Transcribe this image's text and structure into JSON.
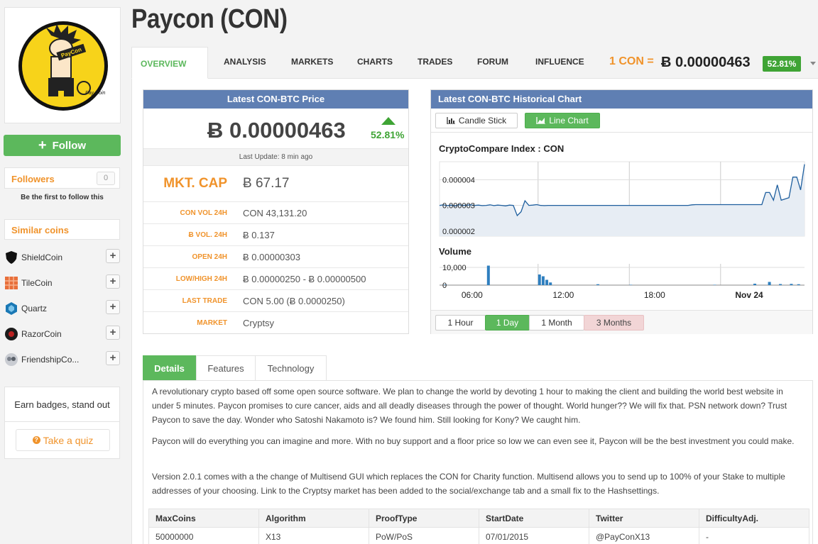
{
  "coin": {
    "title": "Paycon (CON)",
    "logo_text": "PayCon",
    "logo_sub": "Pay Coin"
  },
  "sidebar": {
    "follow_label": "Follow",
    "followers_label": "Followers",
    "followers_count": "0",
    "be_first": "Be the first to follow this",
    "similar_title": "Similar coins",
    "similar": [
      {
        "name": "ShieldCoin",
        "icon": "shield-coin-icon"
      },
      {
        "name": "TileCoin",
        "icon": "tile-coin-icon"
      },
      {
        "name": "Quartz",
        "icon": "quartz-icon"
      },
      {
        "name": "RazorCoin",
        "icon": "razor-coin-icon"
      },
      {
        "name": "FriendshipCo...",
        "icon": "friendship-coin-icon"
      }
    ],
    "badges_text": "Earn badges, stand out",
    "quiz_label": "Take a quiz"
  },
  "nav": {
    "tabs": [
      "OVERVIEW",
      "ANALYSIS",
      "MARKETS",
      "CHARTS",
      "TRADES",
      "FORUM",
      "INFLUENCE"
    ],
    "price_unit": "1 CON =",
    "price_value": "Ƀ 0.00000463",
    "change": "52.81%"
  },
  "latest_price": {
    "title": "Latest CON-BTC Price",
    "price": "Ƀ 0.00000463",
    "change": "52.81%",
    "last_update": "Last Update: 8 min ago",
    "rows": [
      {
        "key": "MKT. CAP",
        "value": "Ƀ 67.17"
      },
      {
        "key": "CON VOL 24H",
        "value": "CON 43,131.20"
      },
      {
        "key": "Ƀ VOL. 24H",
        "value": "Ƀ 0.137"
      },
      {
        "key": "OPEN 24H",
        "value": "Ƀ 0.00000303"
      },
      {
        "key": "LOW/HIGH 24H",
        "value": "Ƀ 0.00000250 - Ƀ 0.00000500"
      },
      {
        "key": "LAST TRADE",
        "value": "CON 5.00 (Ƀ 0.0000250)"
      },
      {
        "key": "MARKET",
        "value": "Cryptsy"
      }
    ]
  },
  "hist_chart": {
    "title": "Latest CON-BTC Historical Chart",
    "candle_label": "Candle Stick",
    "line_label": "Line Chart",
    "chart_title": "CryptoCompare Index : CON",
    "volume_title": "Volume",
    "ranges": [
      "1 Hour",
      "1 Day",
      "1 Month",
      "3 Months"
    ],
    "colors": {
      "line": "#1f5f9e",
      "fill": "#e7edf4",
      "volume": "#2f7fbf"
    }
  },
  "chart_data": {
    "type": "line",
    "title": "CryptoCompare Index : CON",
    "x_tick_labels": [
      "06:00",
      "12:00",
      "18:00",
      "Nov 24"
    ],
    "y_tick_labels": [
      "0.000004",
      "0.000003",
      "0.000002"
    ],
    "ylim": [
      1.8e-06,
      4.7e-06
    ],
    "series": [
      {
        "values": [
          3e-06,
          3.02e-06,
          2.99e-06,
          3.01e-06,
          2.98e-06,
          3.03e-06,
          3e-06,
          3.01e-06,
          3.02e-06,
          3e-06,
          3.01e-06,
          2.99e-06,
          3e-06,
          3.02e-06,
          2.99e-06,
          3.01e-06,
          3e-06,
          2.98e-06,
          3.01e-06,
          3e-06,
          2.6e-06,
          2.75e-06,
          3.18e-06,
          3e-06,
          3.01e-06,
          3.03e-06,
          3e-06,
          2.99e-06,
          3e-06,
          3e-06,
          3e-06,
          3e-06,
          3e-06,
          3e-06,
          3e-06,
          3e-06,
          3e-06,
          3e-06,
          3e-06,
          3e-06,
          3e-06,
          3e-06,
          3e-06,
          3e-06,
          3e-06,
          3e-06,
          3e-06,
          3e-06,
          3e-06,
          3e-06,
          3e-06,
          3e-06,
          3e-06,
          3e-06,
          3e-06,
          3e-06,
          3e-06,
          3e-06,
          3e-06,
          3e-06,
          3e-06,
          3e-06,
          3e-06,
          3e-06,
          3e-06,
          3.02e-06,
          3.03e-06,
          3.03e-06,
          3.03e-06,
          3.03e-06,
          3.03e-06,
          3.03e-06,
          3.03e-06,
          3.03e-06,
          3.03e-06,
          3.03e-06,
          3.03e-06,
          3.03e-06,
          3.03e-06,
          3.03e-06,
          3.03e-06,
          3.03e-06,
          3.03e-06,
          3.03e-06,
          3.5e-06,
          3.5e-06,
          3.2e-06,
          3.8e-06,
          3.2e-06,
          3.25e-06,
          3.3e-06,
          4.1e-06,
          4.1e-06,
          3.6e-06,
          4.6e-06
        ]
      }
    ],
    "volume": {
      "y_tick_labels": [
        "10,000",
        "0"
      ],
      "ylim": [
        0,
        12000
      ],
      "bars": [
        [
          0.012,
          300
        ],
        [
          0.13,
          11000
        ],
        [
          0.27,
          6000
        ],
        [
          0.28,
          5000
        ],
        [
          0.29,
          3000
        ],
        [
          0.3,
          1500
        ],
        [
          0.43,
          500
        ],
        [
          0.52,
          200
        ],
        [
          0.75,
          200
        ],
        [
          0.86,
          800
        ],
        [
          0.9,
          1800
        ],
        [
          0.93,
          600
        ],
        [
          0.96,
          700
        ],
        [
          0.98,
          500
        ]
      ]
    }
  },
  "details": {
    "tabs": [
      "Details",
      "Features",
      "Technology"
    ],
    "paragraphs": [
      "A revolutionary crypto based off some open source software. We plan to change the world by devoting 1 hour to making the client and building the world best website in under 5 minutes. Paycon promises to cure cancer, aids and all deadly diseases through the power of thought. World hunger?? We will fix that. PSN network down? Trust Paycon to save the day. Wonder who Satoshi Nakamoto is? We found him. Still looking for Kony? We caught him.",
      "Paycon will do everything you can imagine and more. With no buy support and a floor price so low we can even see it, Paycon will be the best investment you could make.",
      "Version 2.0.1 comes with a the change of Multisend GUI which replaces the CON for Charity function. Multisend allows you to send up to 100% of your Stake to multiple addresses of your choosing. Link to the Cryptsy market has been added to the social/exchange tab and a small fix to the Hashsettings."
    ],
    "spec_headers": [
      "MaxCoins",
      "Algorithm",
      "ProofType",
      "StartDate",
      "Twitter",
      "DifficultyAdj."
    ],
    "spec_values": [
      "50000000",
      "X13",
      "PoW/PoS",
      "07/01/2015",
      "@PayConX13",
      "-"
    ]
  }
}
